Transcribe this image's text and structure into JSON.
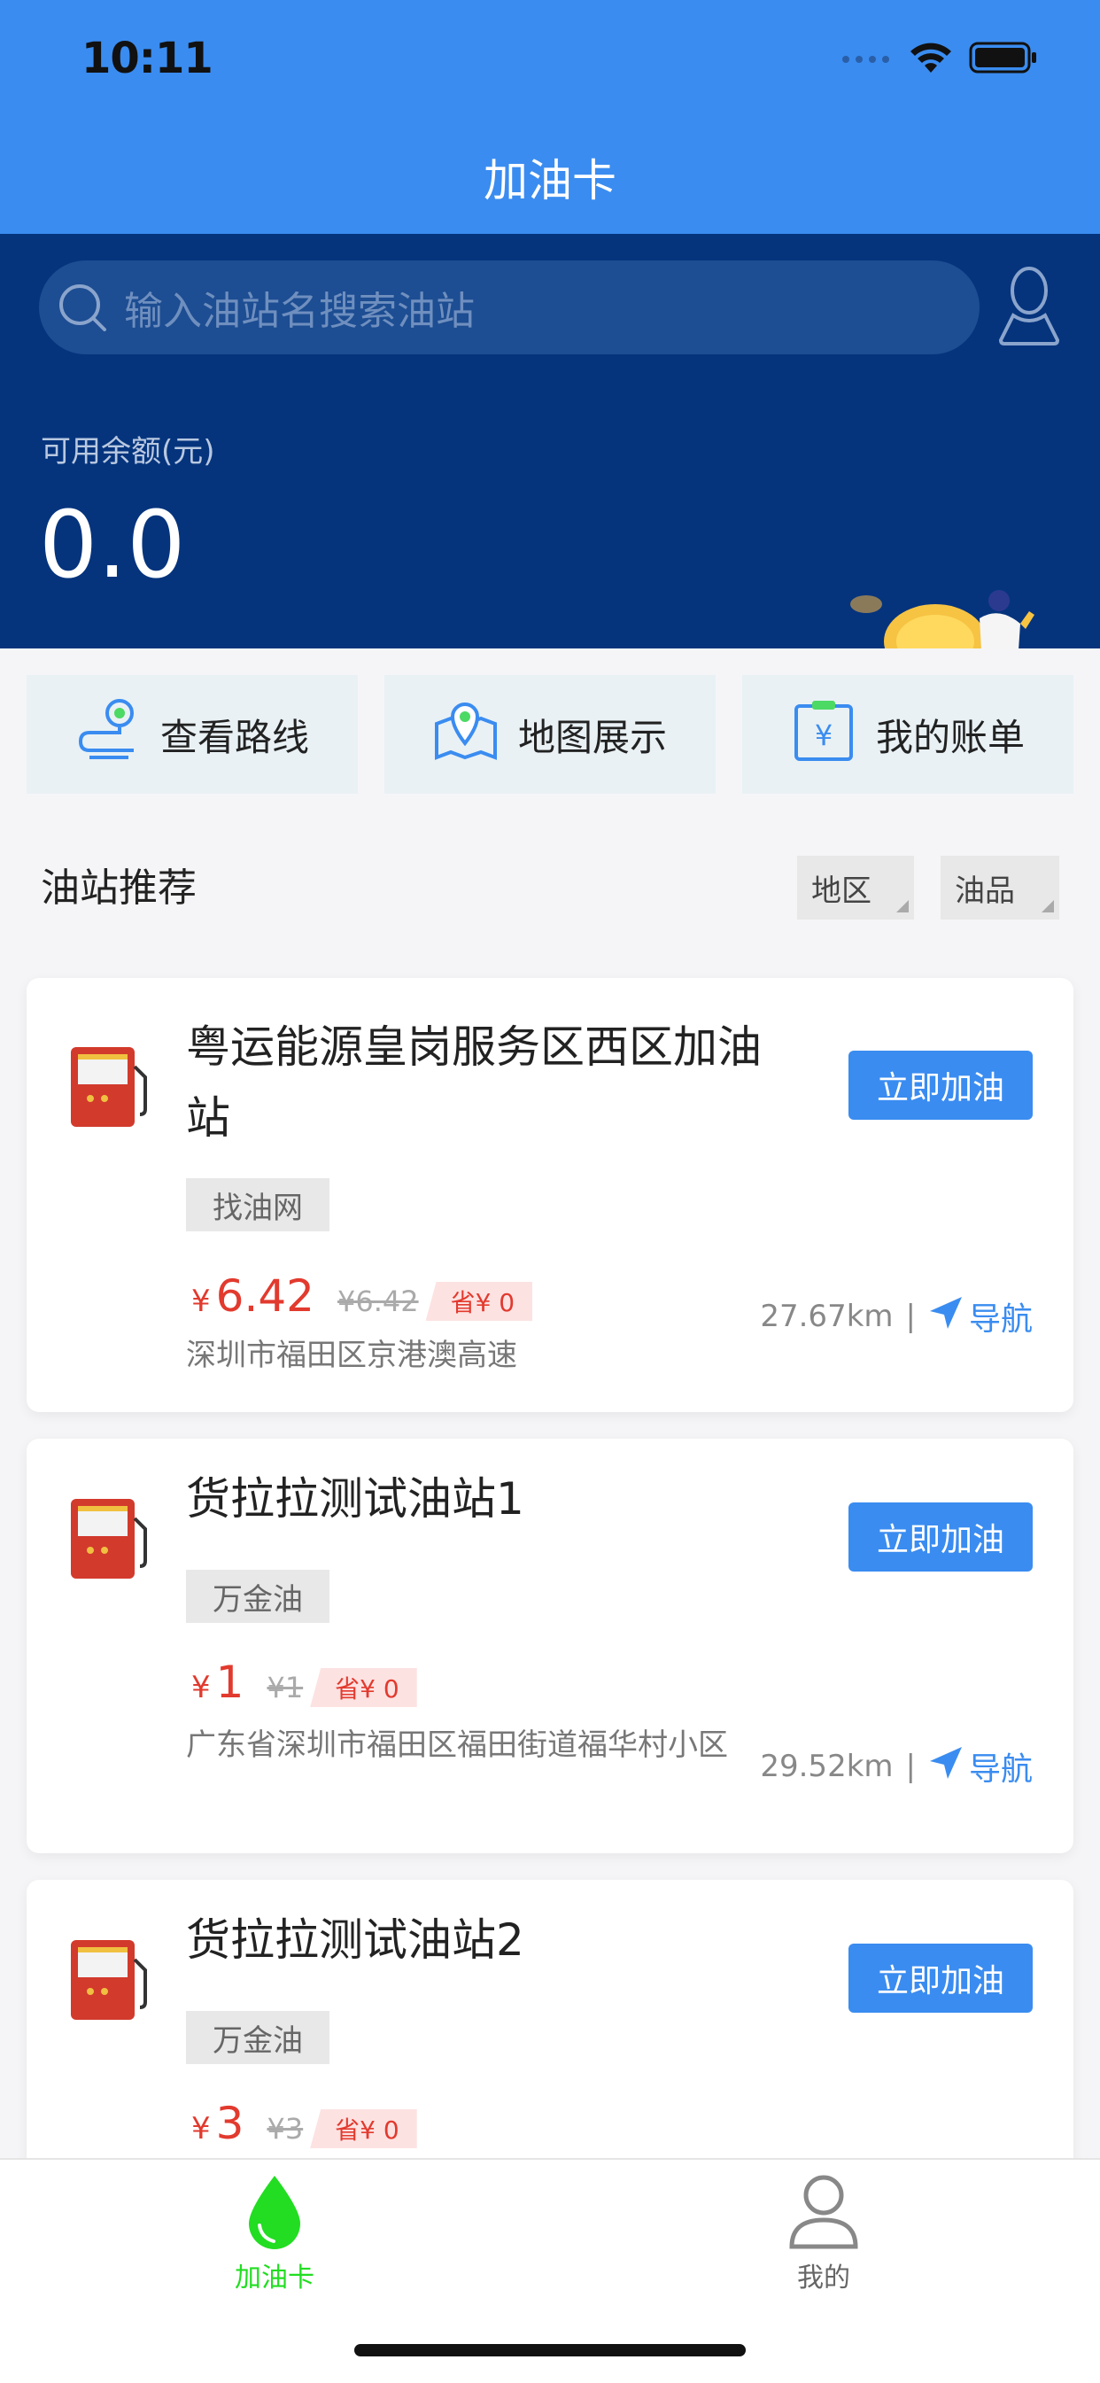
{
  "status_bar": {
    "time": "10:11"
  },
  "nav": {
    "title": "加油卡"
  },
  "hero": {
    "search_placeholder": "输入油站名搜索油站",
    "balance_label": "可用余额(元)",
    "balance_value": "0.0"
  },
  "quick_actions": [
    {
      "label": "查看路线",
      "icon": "route-icon"
    },
    {
      "label": "地图展示",
      "icon": "map-icon"
    },
    {
      "label": "我的账单",
      "icon": "bill-icon"
    }
  ],
  "section": {
    "title": "油站推荐",
    "filters": [
      "地区",
      "油品"
    ]
  },
  "stations": [
    {
      "name": "粤运能源皇岗服务区西区加油站",
      "tag": "找油网",
      "currency": "¥",
      "price": "6.42",
      "original_price": "¥6.42",
      "save": "省¥ 0",
      "address": "深圳市福田区京港澳高速",
      "distance": "27.67km",
      "separator": "|",
      "nav_label": "导航",
      "button_label": "立即加油"
    },
    {
      "name": "货拉拉测试油站1",
      "tag": "万金油",
      "currency": "¥",
      "price": "1",
      "original_price": "¥1",
      "save": "省¥ 0",
      "address": "广东省深圳市福田区福田街道福华村小区",
      "distance": "29.52km",
      "separator": "|",
      "nav_label": "导航",
      "button_label": "立即加油"
    },
    {
      "name": "货拉拉测试油站2",
      "tag": "万金油",
      "currency": "¥",
      "price": "3",
      "original_price": "¥3",
      "save": "省¥ 0",
      "button_label": "立即加油"
    }
  ],
  "tabbar": {
    "items": [
      {
        "label": "加油卡",
        "icon": "drop-icon",
        "active": true
      },
      {
        "label": "我的",
        "icon": "person-icon",
        "active": false
      }
    ]
  },
  "colors": {
    "primary": "#3a8cf0",
    "hero": "#05347d",
    "price": "#e23a2e",
    "tab_active": "#22dd22"
  }
}
